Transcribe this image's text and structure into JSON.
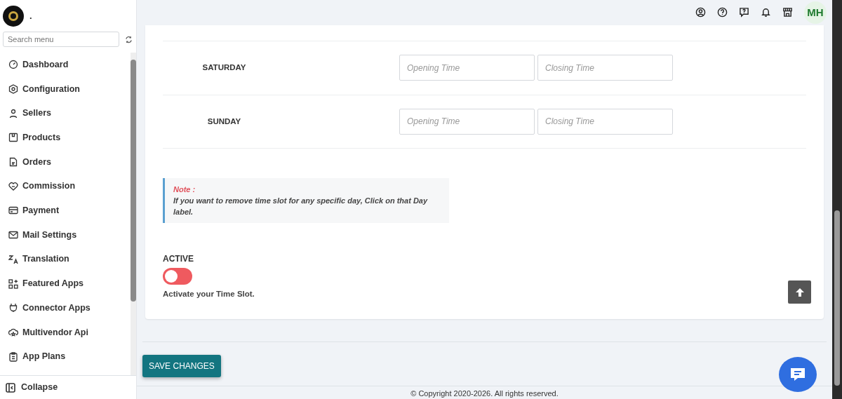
{
  "sidebar": {
    "brand": ".",
    "search": {
      "placeholder": "Search menu"
    },
    "items": [
      {
        "label": "Dashboard"
      },
      {
        "label": "Configuration"
      },
      {
        "label": "Sellers"
      },
      {
        "label": "Products"
      },
      {
        "label": "Orders"
      },
      {
        "label": "Commission"
      },
      {
        "label": "Payment"
      },
      {
        "label": "Mail Settings"
      },
      {
        "label": "Translation"
      },
      {
        "label": "Featured Apps"
      },
      {
        "label": "Connector Apps"
      },
      {
        "label": "Multivendor Api"
      },
      {
        "label": "App Plans"
      }
    ],
    "collapse": "Collapse"
  },
  "header": {
    "avatar": "MH"
  },
  "schedule": [
    {
      "day": "SATURDAY",
      "opening_placeholder": "Opening Time",
      "closing_placeholder": "Closing Time"
    },
    {
      "day": "SUNDAY",
      "opening_placeholder": "Opening Time",
      "closing_placeholder": "Closing Time"
    }
  ],
  "note": {
    "title": "Note :",
    "text": "If you want to remove time slot for any specific day, Click on that Day label."
  },
  "active": {
    "label": "ACTIVE",
    "on": false,
    "help": "Activate your Time Slot."
  },
  "save_button": "SAVE CHANGES",
  "footer": "© Copyright 2020-2026. All rights reserved."
}
